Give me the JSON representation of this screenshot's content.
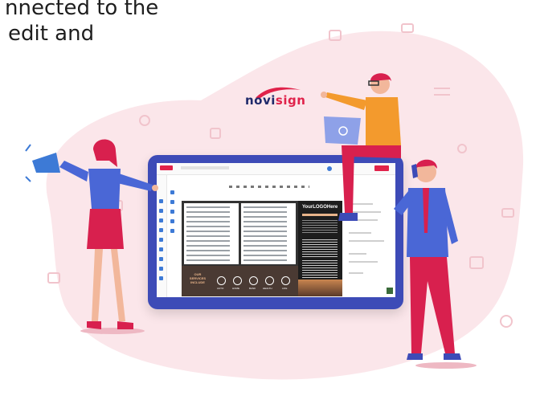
{
  "headline": {
    "line1": "nnected to the",
    "line2": "edit and"
  },
  "brand": {
    "name_part1": "novi",
    "name_part2": "sign",
    "primary_color": "#1f2a6b",
    "accent_color": "#e0224a"
  },
  "screen": {
    "logo_text": "YourLOGOHere",
    "banner_title": "OUR SERVICES INCLUDE",
    "banner_items": [
      "AUTO",
      "HOME",
      "BANK",
      "HEALTH",
      "LIFE"
    ]
  },
  "colors": {
    "blob": "#fbe6ea",
    "tablet": "#3d4bb7",
    "shirt_blue": "#4a67d6",
    "pants_red": "#d8204e",
    "shirt_orange": "#f39a2d"
  }
}
